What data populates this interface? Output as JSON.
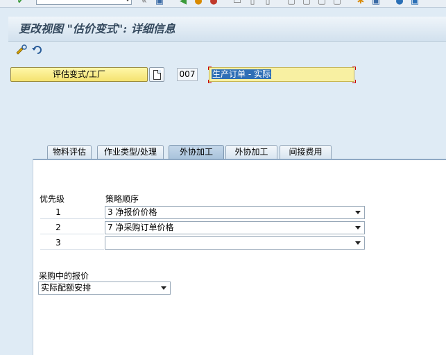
{
  "window": {
    "title": "更改视图 \"估价变式\": 详细信息"
  },
  "header": {
    "button_label": "评估变式/工厂",
    "code": "007",
    "description": "生产订单 - 实际"
  },
  "tabs": [
    {
      "label": "物料评估"
    },
    {
      "label": "作业类型/处理"
    },
    {
      "label": "外协加工"
    },
    {
      "label": "外协加工"
    },
    {
      "label": "间接费用"
    }
  ],
  "strategy": {
    "priority_label": "优先级",
    "sequence_label": "策略顺序",
    "rows": [
      {
        "priority": "1",
        "value": "3 净报价价格"
      },
      {
        "priority": "2",
        "value": "7 净采购订单价格"
      },
      {
        "priority": "3",
        "value": ""
      }
    ]
  },
  "purchasing_quote": {
    "label": "采购中的报价",
    "value": "实际配额安排"
  }
}
